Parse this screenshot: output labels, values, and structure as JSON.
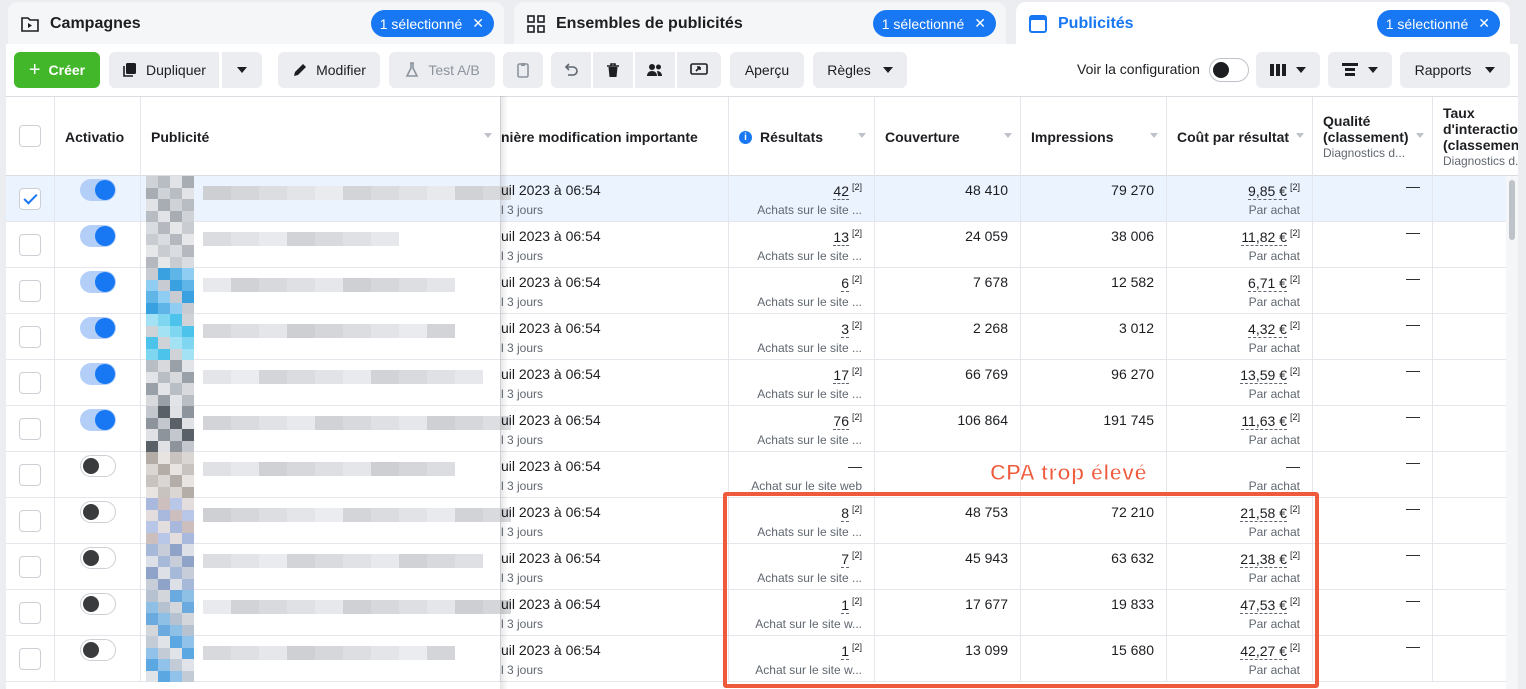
{
  "tabs": [
    {
      "label": "Campagnes",
      "pill": "1 sélectionné"
    },
    {
      "label": "Ensembles de publicités",
      "pill": "1 sélectionné"
    },
    {
      "label": "Publicités",
      "pill": "1 sélectionné"
    }
  ],
  "toolbar": {
    "create": "Créer",
    "duplicate": "Dupliquer",
    "edit": "Modifier",
    "ab_test": "Test A/B",
    "preview": "Aperçu",
    "rules": "Règles",
    "view_config": "Voir la configuration",
    "reports": "Rapports"
  },
  "columns": {
    "activation": "Activatio",
    "ad": "Publicité",
    "last_edit": "nière modification importante",
    "results": "Résultats",
    "reach": "Couverture",
    "impressions": "Impressions",
    "cost": "Coût par résultat",
    "quality_title": "Qualité (classement)",
    "quality_sub": "Diagnostics d...",
    "engage_title": "Taux d'interaction (classement)",
    "engage_sub": "Diagnostics d..."
  },
  "rows": [
    {
      "checked": true,
      "active": true,
      "date": "uil 2023 à 06:54",
      "ago": "l 3 jours",
      "result": "42",
      "result_label": "Achats sur le site ...",
      "reach": "48 410",
      "impressions": "79 270",
      "cost": "9,85 €",
      "cost_label": "Par achat",
      "quality": "—",
      "engagement": ""
    },
    {
      "checked": false,
      "active": true,
      "date": "uil 2023 à 06:54",
      "ago": "l 3 jours",
      "result": "13",
      "result_label": "Achats sur le site ...",
      "reach": "24 059",
      "impressions": "38 006",
      "cost": "11,82 €",
      "cost_label": "Par achat",
      "quality": "—",
      "engagement": ""
    },
    {
      "checked": false,
      "active": true,
      "date": "uil 2023 à 06:54",
      "ago": "l 3 jours",
      "result": "6",
      "result_label": "Achats sur le site ...",
      "reach": "7 678",
      "impressions": "12 582",
      "cost": "6,71 €",
      "cost_label": "Par achat",
      "quality": "—",
      "engagement": ""
    },
    {
      "checked": false,
      "active": true,
      "date": "uil 2023 à 06:54",
      "ago": "l 3 jours",
      "result": "3",
      "result_label": "Achats sur le site ...",
      "reach": "2 268",
      "impressions": "3 012",
      "cost": "4,32 €",
      "cost_label": "Par achat",
      "quality": "—",
      "engagement": ""
    },
    {
      "checked": false,
      "active": true,
      "date": "uil 2023 à 06:54",
      "ago": "l 3 jours",
      "result": "17",
      "result_label": "Achats sur le site ...",
      "reach": "66 769",
      "impressions": "96 270",
      "cost": "13,59 €",
      "cost_label": "Par achat",
      "quality": "—",
      "engagement": ""
    },
    {
      "checked": false,
      "active": true,
      "date": "uil 2023 à 06:54",
      "ago": "l 3 jours",
      "result": "76",
      "result_label": "Achats sur le site ...",
      "reach": "106 864",
      "impressions": "191 745",
      "cost": "11,63 €",
      "cost_label": "Par achat",
      "quality": "—",
      "engagement": ""
    },
    {
      "checked": false,
      "active": false,
      "date": "uil 2023 à 06:54",
      "ago": "l 3 jours",
      "result": "—",
      "result_label": "Achat sur le site web",
      "reach": "",
      "impressions": "",
      "cost": "—",
      "cost_label": "Par achat",
      "quality": "—",
      "engagement": ""
    },
    {
      "checked": false,
      "active": false,
      "date": "uil 2023 à 06:54",
      "ago": "l 3 jours",
      "result": "8",
      "result_label": "Achats sur le site ...",
      "reach": "48 753",
      "impressions": "72 210",
      "cost": "21,58 €",
      "cost_label": "Par achat",
      "quality": "—",
      "engagement": ""
    },
    {
      "checked": false,
      "active": false,
      "date": "uil 2023 à 06:54",
      "ago": "l 3 jours",
      "result": "7",
      "result_label": "Achats sur le site ...",
      "reach": "45 943",
      "impressions": "63 632",
      "cost": "21,38 €",
      "cost_label": "Par achat",
      "quality": "—",
      "engagement": ""
    },
    {
      "checked": false,
      "active": false,
      "date": "uil 2023 à 06:54",
      "ago": "l 3 jours",
      "result": "1",
      "result_label": "Achat sur le site w...",
      "reach": "17 677",
      "impressions": "19 833",
      "cost": "47,53 €",
      "cost_label": "Par achat",
      "quality": "—",
      "engagement": ""
    },
    {
      "checked": false,
      "active": false,
      "date": "uil 2023 à 06:54",
      "ago": "l 3 jours",
      "result": "1",
      "result_label": "Achat sur le site w...",
      "reach": "13 099",
      "impressions": "15 680",
      "cost": "42,27 €",
      "cost_label": "Par achat",
      "quality": "—",
      "engagement": ""
    }
  ],
  "superscript": "[2]",
  "annotation": {
    "text": "CPA trop élevé",
    "color": "#f05a3c"
  },
  "colors": {
    "primary": "#1877f2",
    "create": "#42b72a",
    "selected_row": "#ebf3ff"
  }
}
